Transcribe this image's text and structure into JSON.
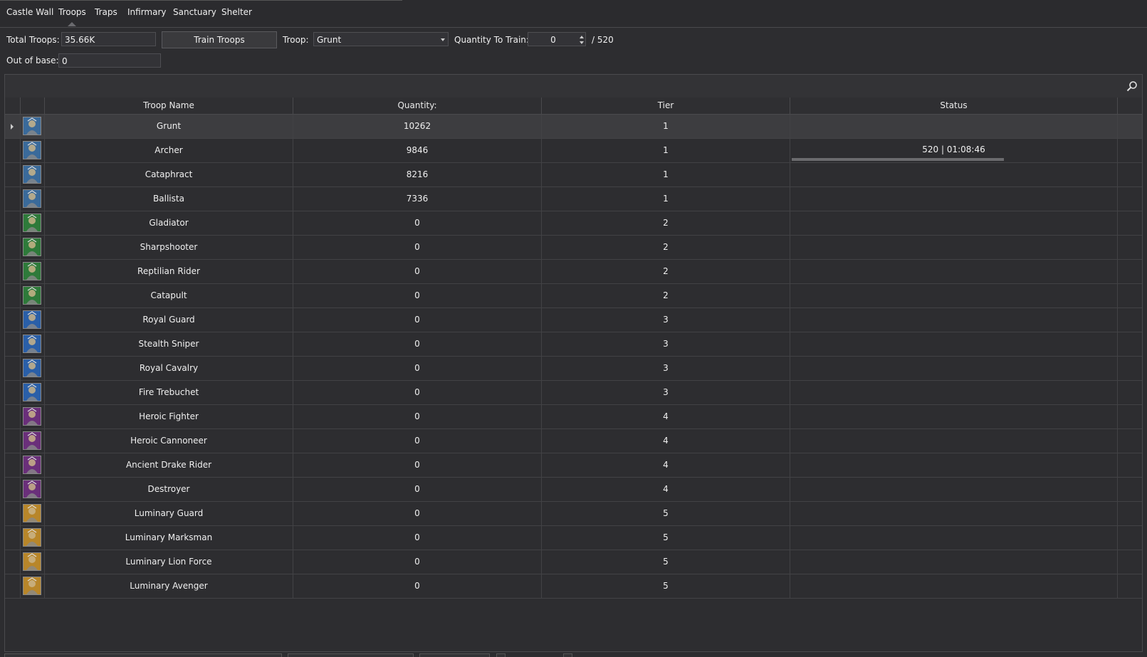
{
  "tabs": [
    {
      "label": "Castle Wall"
    },
    {
      "label": "Troops"
    },
    {
      "label": "Traps"
    },
    {
      "label": "Infirmary"
    },
    {
      "label": "Sanctuary"
    },
    {
      "label": "Shelter"
    }
  ],
  "active_tab": "Troops",
  "form": {
    "total_troops_label": "Total Troops:",
    "total_troops_value": "35.66K",
    "train_button": "Train Troops",
    "troop_label": "Troop:",
    "troop_value": "Grunt",
    "quantity_label": "Quantity To Train:",
    "quantity_value": "0",
    "quantity_max": "/ 520",
    "out_of_base_label": "Out of base:",
    "out_of_base_value": "0"
  },
  "table": {
    "columns": [
      "Troop Name",
      "Quantity:",
      "Tier",
      "Status"
    ],
    "rows": [
      {
        "name": "Grunt",
        "quantity": "10262",
        "tier": "1",
        "status": "",
        "icon": "grunt-icon",
        "color": "#3a6a9a"
      },
      {
        "name": "Archer",
        "quantity": "9846",
        "tier": "1",
        "status": "520 | 01:08:46",
        "progress": 1.0,
        "icon": "archer-icon",
        "color": "#3a6a9a"
      },
      {
        "name": "Cataphract",
        "quantity": "8216",
        "tier": "1",
        "status": "",
        "icon": "cataphract-icon",
        "color": "#3a6a9a"
      },
      {
        "name": "Ballista",
        "quantity": "7336",
        "tier": "1",
        "status": "",
        "icon": "ballista-icon",
        "color": "#3a6a9a"
      },
      {
        "name": "Gladiator",
        "quantity": "0",
        "tier": "2",
        "status": "",
        "icon": "gladiator-icon",
        "color": "#2e7a3a"
      },
      {
        "name": "Sharpshooter",
        "quantity": "0",
        "tier": "2",
        "status": "",
        "icon": "sharpshooter-icon",
        "color": "#2e7a3a"
      },
      {
        "name": "Reptilian Rider",
        "quantity": "0",
        "tier": "2",
        "status": "",
        "icon": "reptilian-rider-icon",
        "color": "#2e7a3a"
      },
      {
        "name": "Catapult",
        "quantity": "0",
        "tier": "2",
        "status": "",
        "icon": "catapult-icon",
        "color": "#2e7a3a"
      },
      {
        "name": "Royal Guard",
        "quantity": "0",
        "tier": "3",
        "status": "",
        "icon": "royal-guard-icon",
        "color": "#2a5fa8"
      },
      {
        "name": "Stealth Sniper",
        "quantity": "0",
        "tier": "3",
        "status": "",
        "icon": "stealth-sniper-icon",
        "color": "#2a5fa8"
      },
      {
        "name": "Royal Cavalry",
        "quantity": "0",
        "tier": "3",
        "status": "",
        "icon": "royal-cavalry-icon",
        "color": "#2a5fa8"
      },
      {
        "name": "Fire Trebuchet",
        "quantity": "0",
        "tier": "3",
        "status": "",
        "icon": "fire-trebuchet-icon",
        "color": "#2a5fa8"
      },
      {
        "name": "Heroic Fighter",
        "quantity": "0",
        "tier": "4",
        "status": "",
        "icon": "heroic-fighter-icon",
        "color": "#6a2f7a"
      },
      {
        "name": "Heroic Cannoneer",
        "quantity": "0",
        "tier": "4",
        "status": "",
        "icon": "heroic-cannoneer-icon",
        "color": "#6a2f7a"
      },
      {
        "name": "Ancient Drake Rider",
        "quantity": "0",
        "tier": "4",
        "status": "",
        "icon": "ancient-drake-rider-icon",
        "color": "#6a2f7a"
      },
      {
        "name": "Destroyer",
        "quantity": "0",
        "tier": "4",
        "status": "",
        "icon": "destroyer-icon",
        "color": "#6a2f7a"
      },
      {
        "name": "Luminary Guard",
        "quantity": "0",
        "tier": "5",
        "status": "",
        "icon": "luminary-guard-icon",
        "color": "#b8862a"
      },
      {
        "name": "Luminary Marksman",
        "quantity": "0",
        "tier": "5",
        "status": "",
        "icon": "luminary-marksman-icon",
        "color": "#b8862a"
      },
      {
        "name": "Luminary Lion Force",
        "quantity": "0",
        "tier": "5",
        "status": "",
        "icon": "luminary-lion-force-icon",
        "color": "#b8862a"
      },
      {
        "name": "Luminary Avenger",
        "quantity": "0",
        "tier": "5",
        "status": "",
        "icon": "luminary-avenger-icon",
        "color": "#b8862a"
      }
    ],
    "selected_row": "Grunt"
  },
  "colors": {
    "background": "#2d2d30",
    "selected_row": "#3d3d40",
    "progress": "#6b6b6e"
  }
}
